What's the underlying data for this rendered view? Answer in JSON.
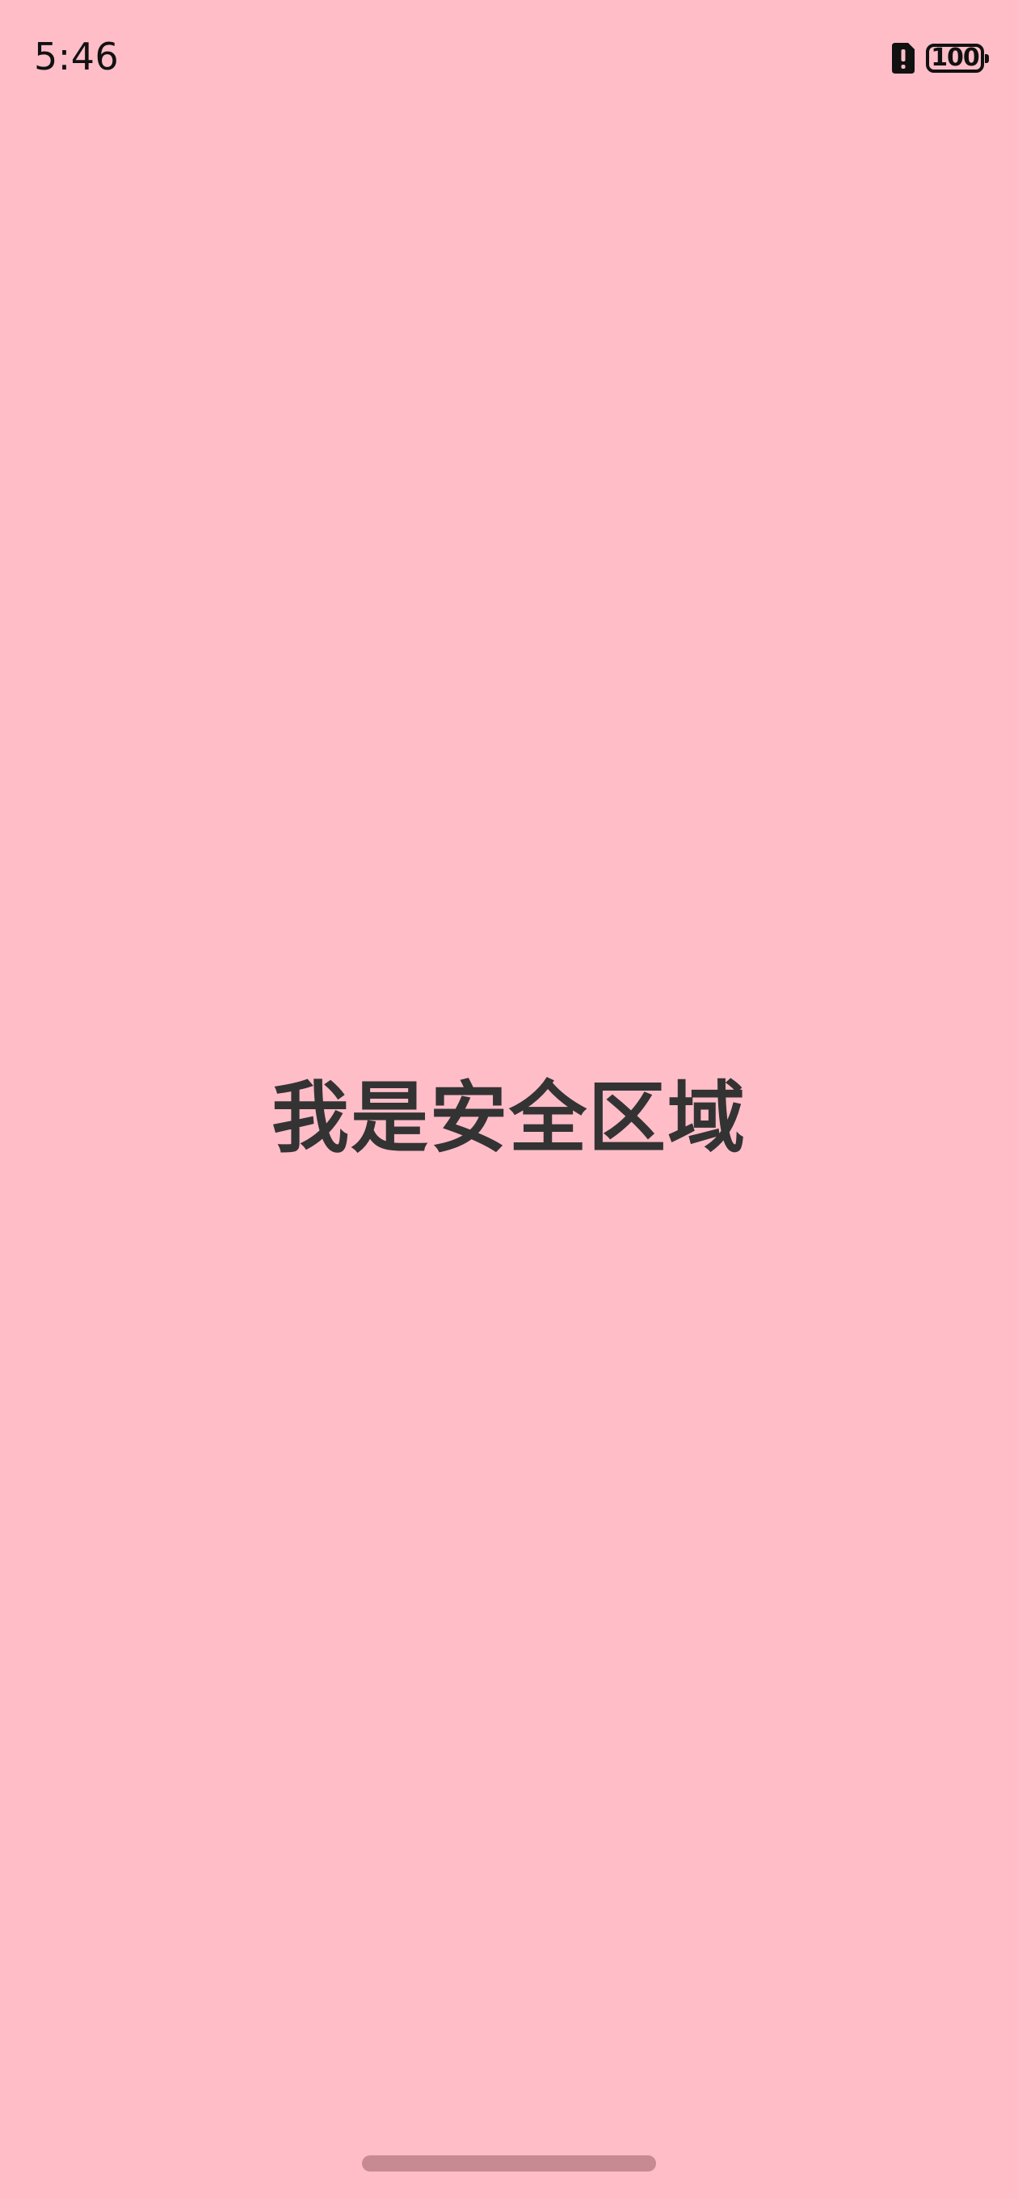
{
  "status_bar": {
    "time": "5:46",
    "alert_icon": "alert-icon",
    "battery_level": "100",
    "battery_percent": 100
  },
  "main": {
    "label": "我是安全区域"
  },
  "colors": {
    "background": "#ffbdc8",
    "label": "#333333",
    "home_indicator": "#c88a92"
  }
}
